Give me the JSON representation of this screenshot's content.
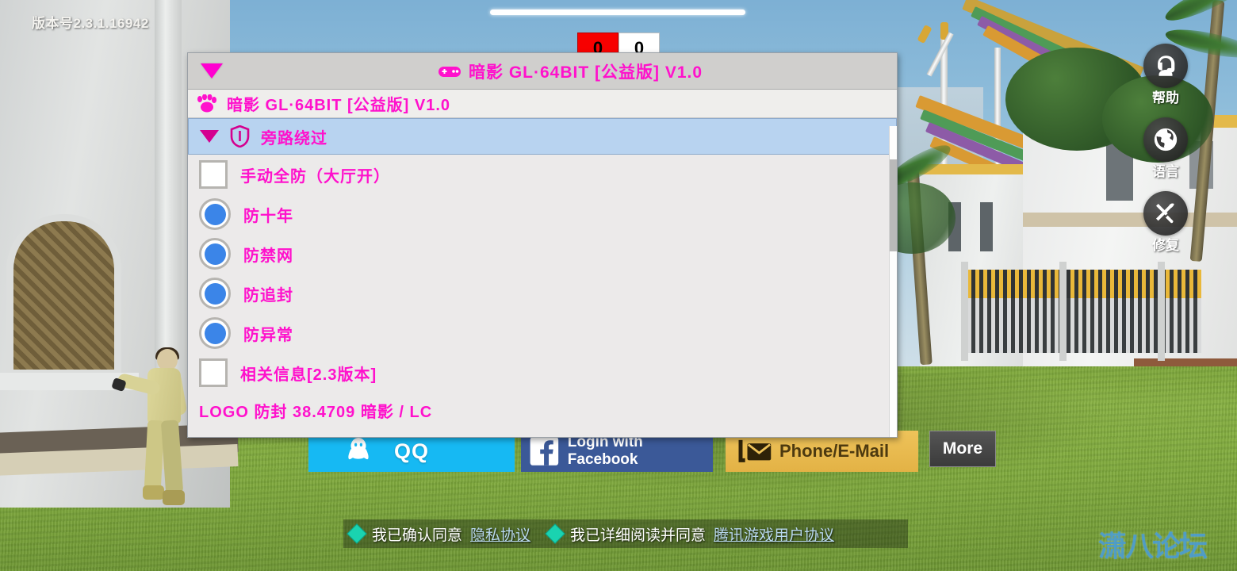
{
  "game": {
    "version_label": "版本号2.3.1.16942",
    "watermark": "潇八论坛",
    "progress_percent": 100,
    "side_icons": [
      {
        "label": "帮助",
        "icon": "headset-support-icon"
      },
      {
        "label": "语言",
        "icon": "globe-icon"
      },
      {
        "label": "修复",
        "icon": "wrench-screwdriver-icon"
      }
    ],
    "login_buttons": [
      {
        "label": "QQ",
        "icon": "qq-penguin-icon",
        "color": "#16b9f3"
      },
      {
        "label": "Login with Facebook",
        "icon": "facebook-icon",
        "color": "#3b5998"
      },
      {
        "label": "Phone/E-Mail",
        "icon": "envelope-icon",
        "color": "#e8bb4f"
      },
      {
        "label": "More",
        "icon": "more-icon",
        "color": "#3b3b3b"
      }
    ],
    "agreements": [
      {
        "checkbox": "checked",
        "text": "我已确认同意",
        "link": "隐私协议"
      },
      {
        "checkbox": "checked",
        "text": "我已详细阅读并同意",
        "link": "腾讯游戏用户协议"
      }
    ]
  },
  "badges": [
    {
      "value": "0",
      "style": "red"
    },
    {
      "value": "0",
      "style": "white"
    }
  ],
  "panel": {
    "title": "暗影 GL·64BIT [公益版] V1.0",
    "title_icon": "gamepad-icon",
    "collapse_icon": "triangle-down-icon",
    "header_row": {
      "icon": "paw-print-icon",
      "text": "暗影 GL·64BIT [公益版] V1.0"
    },
    "section": {
      "icon": "shield-icon",
      "collapse_icon": "triangle-down-icon",
      "label": "旁路绕过"
    },
    "options": [
      {
        "type": "checkbox",
        "checked": false,
        "label": "手动全防（大厅开）"
      },
      {
        "type": "radio",
        "checked": true,
        "label": "防十年"
      },
      {
        "type": "radio",
        "checked": true,
        "label": "防禁网"
      },
      {
        "type": "radio",
        "checked": true,
        "label": "防追封"
      },
      {
        "type": "radio",
        "checked": true,
        "label": "防异常"
      },
      {
        "type": "checkbox",
        "checked": false,
        "label": "相关信息[2.3版本]"
      }
    ],
    "footer": "LOGO 防封 38.4709 暗影 / LC",
    "accent_color": "#ff11cc",
    "section_bg": "#b8d3f0"
  }
}
